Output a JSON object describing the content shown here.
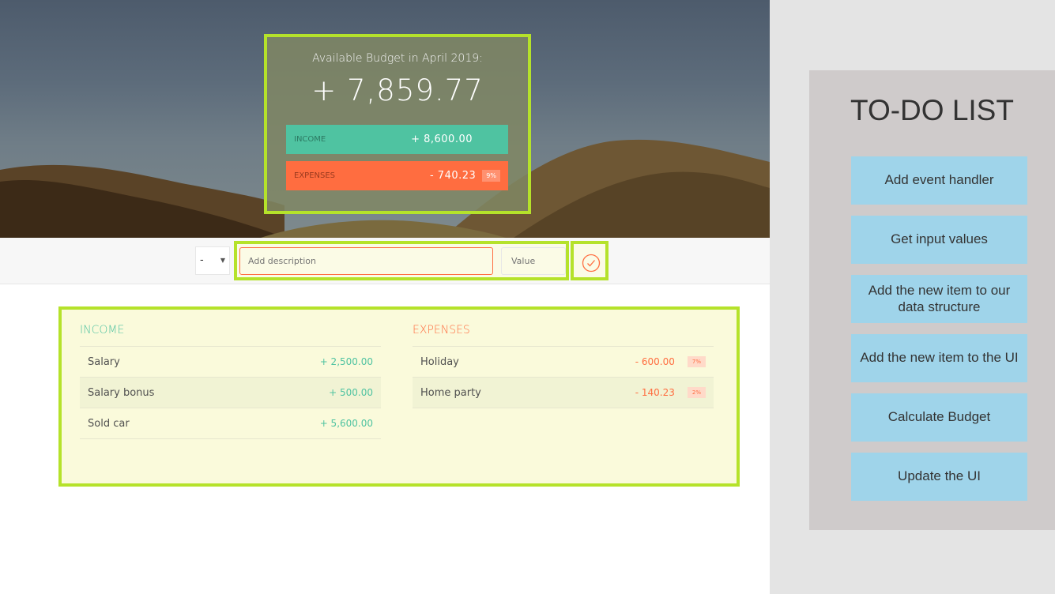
{
  "budget": {
    "title": "Available Budget in April 2019:",
    "value": "+ 7,859.77",
    "income_label": "Income",
    "income_value": "+ 8,600.00",
    "expenses_label": "Expenses",
    "expenses_value": "- 740.23",
    "expenses_percentage": "9%"
  },
  "add": {
    "type_value": "-",
    "description_placeholder": "Add description",
    "value_placeholder": "Value"
  },
  "income": {
    "title": "INCOME",
    "items": [
      {
        "description": "Salary",
        "value": "+ 2,500.00"
      },
      {
        "description": "Salary bonus",
        "value": "+ 500.00"
      },
      {
        "description": "Sold car",
        "value": "+ 5,600.00"
      }
    ]
  },
  "expenses": {
    "title": "EXPENSES",
    "items": [
      {
        "description": "Holiday",
        "value": "- 600.00",
        "percentage": "7%"
      },
      {
        "description": "Home party",
        "value": "- 140.23",
        "percentage": "2%"
      }
    ]
  },
  "todo": {
    "title": "TO-DO LIST",
    "items": [
      "Add event handler",
      "Get input values",
      "Add the new item to our data structure",
      "Add the new item to the UI",
      "Calculate Budget",
      "Update the UI"
    ]
  },
  "colors": {
    "income": "#4fc3a1",
    "expenses": "#ff6d40",
    "highlight": "#b5e22a",
    "todo_item": "#9fd4ea"
  }
}
